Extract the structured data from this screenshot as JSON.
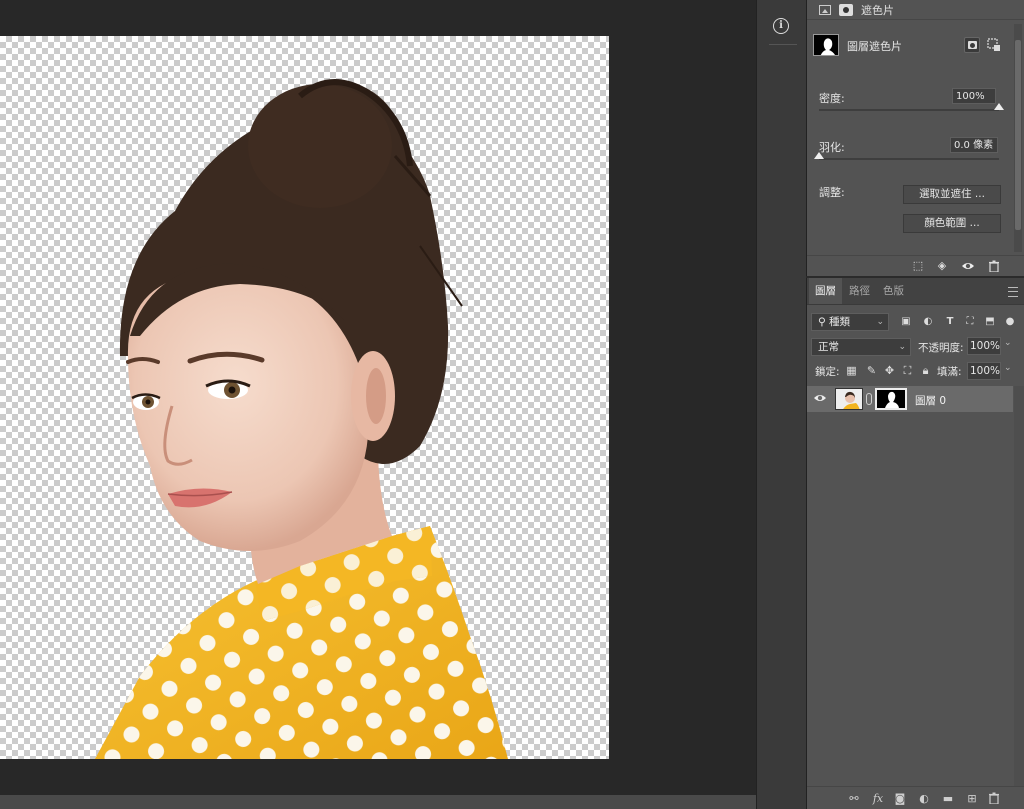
{
  "properties_panel": {
    "title": "遮色片",
    "mask_name": "圖層遮色片",
    "density_label": "密度:",
    "density_value": "100%",
    "density": 1.0,
    "feather_label": "羽化:",
    "feather_value": "0.0 像素",
    "feather": 0.0,
    "refine_label": "調整:",
    "select_and_mask_button": "選取並遮住 ...",
    "color_range_button": "顏色範圍 ..."
  },
  "layers_panel": {
    "tabs": [
      {
        "label": "圖層",
        "active": true
      },
      {
        "label": "路徑",
        "active": false
      },
      {
        "label": "色版",
        "active": false
      }
    ],
    "filter_kind": "種類",
    "blend_mode": "正常",
    "opacity_label": "不透明度:",
    "opacity_value": "100%",
    "lock_label": "鎖定:",
    "fill_label": "填滿:",
    "fill_value": "100%",
    "layer": {
      "name": "圖層 0",
      "visible": true,
      "selected": true
    }
  },
  "icons": {
    "info": "info-icon",
    "image": "image-icon",
    "mask": "mask-icon"
  },
  "colors": {
    "panel_bg": "#535353",
    "app_bg": "#282828",
    "selected_row": "#6a6a6a",
    "shirt": "#f2b41f",
    "hair": "#3b2a20"
  }
}
